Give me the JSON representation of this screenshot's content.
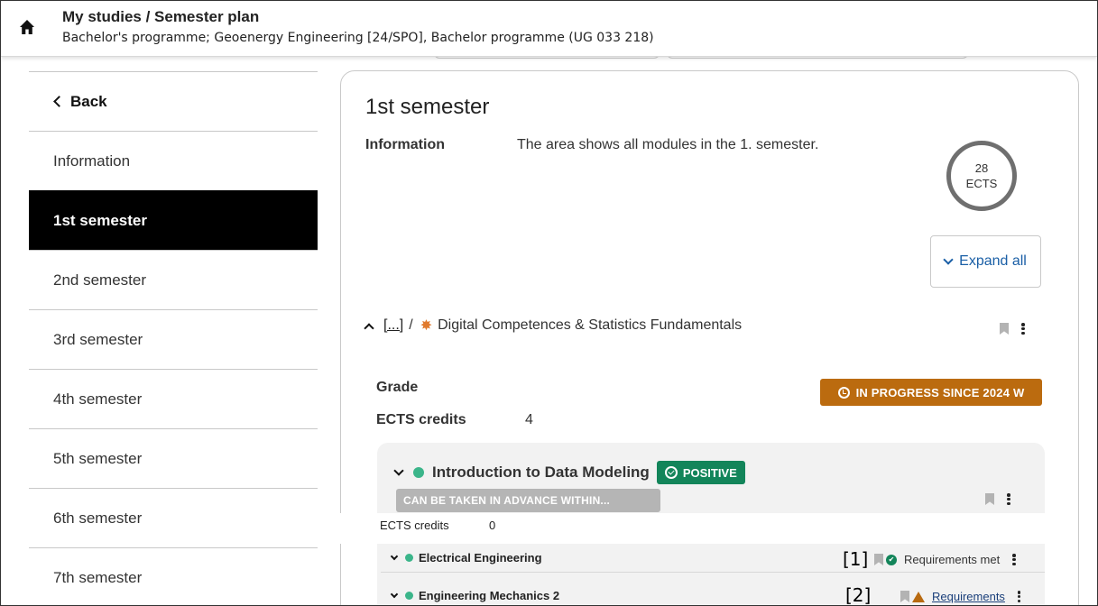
{
  "header": {
    "title": "My studies / Semester plan",
    "subtitle": "Bachelor's programme; Geoenergy Engineering [24/SPO], Bachelor programme (UG 033 218)"
  },
  "sidebar": {
    "back_label": "Back",
    "items": [
      {
        "label": "Information",
        "active": false
      },
      {
        "label": "1st semester",
        "active": true
      },
      {
        "label": "2nd semester",
        "active": false
      },
      {
        "label": "3rd semester",
        "active": false
      },
      {
        "label": "4th semester",
        "active": false
      },
      {
        "label": "5th semester",
        "active": false
      },
      {
        "label": "6th semester",
        "active": false
      },
      {
        "label": "7th semester",
        "active": false
      }
    ]
  },
  "main": {
    "title": "1st semester",
    "info_label": "Information",
    "info_text": "The area shows all modules in the 1. semester.",
    "ects_value": "28",
    "ects_unit": "ECTS",
    "expand_label": "Expand all",
    "module": {
      "breadcrumb_link": "[...]",
      "separator": "/",
      "name": "Digital Competences & Statistics Fundamentals",
      "grade_label": "Grade",
      "ects_label": "ECTS credits",
      "ects_value": "4",
      "status_badge": "IN PROGRESS SINCE 2024 W"
    },
    "submodule": {
      "name": "Introduction to Data Modeling",
      "grade_badge": "POSITIVE",
      "advance_badge": "CAN BE TAKEN IN ADVANCE WITHIN...",
      "ects_label": "ECTS credits",
      "ects_value": "0"
    },
    "courses": [
      {
        "name": "Electrical Engineering",
        "marker": "[1]",
        "requirements": "Requirements met",
        "requirements_met": true
      },
      {
        "name": "Engineering Mechanics 2",
        "marker": "[2]",
        "requirements": "Requirements",
        "requirements_met": false
      }
    ]
  },
  "colors": {
    "active_nav": "#000000",
    "link_blue": "#1a5fa6",
    "in_progress": "#bb6b0f",
    "positive": "#13855a",
    "status_dot": "#3bb58a",
    "module_star": "#e07a2e"
  }
}
